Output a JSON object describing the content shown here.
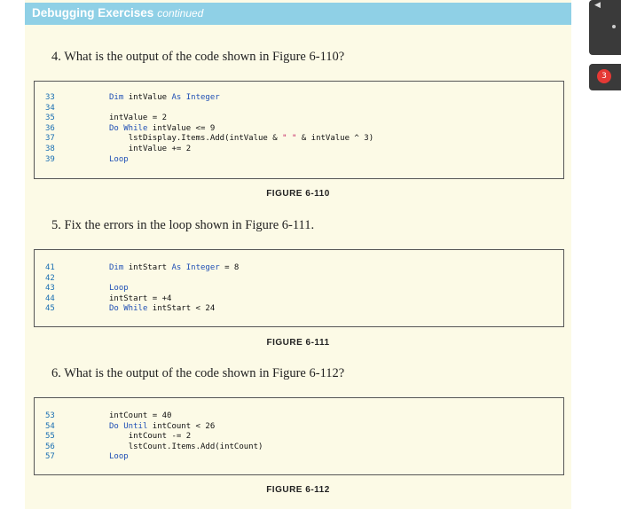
{
  "header": {
    "title": "Debugging Exercises",
    "subtitle": "continued"
  },
  "exercises": [
    {
      "question": "4. What is the output of the code shown in Figure 6-110?",
      "figure": "FIGURE 6-110",
      "lines": [
        {
          "num": "33",
          "code": "Dim intValue As Integer"
        },
        {
          "num": "34",
          "code": ""
        },
        {
          "num": "35",
          "code": "intValue = 2"
        },
        {
          "num": "36",
          "code": "Do While intValue <= 9"
        },
        {
          "num": "37",
          "code": "    lstDisplay.Items.Add(intValue & \" \" & intValue ^ 3)"
        },
        {
          "num": "38",
          "code": "    intValue += 2"
        },
        {
          "num": "39",
          "code": "Loop"
        }
      ]
    },
    {
      "question": "5. Fix the errors in the loop shown in Figure 6-111.",
      "figure": "FIGURE 6-111",
      "lines": [
        {
          "num": "41",
          "code": "Dim intStart As Integer = 8"
        },
        {
          "num": "42",
          "code": ""
        },
        {
          "num": "43",
          "code": "Loop"
        },
        {
          "num": "44",
          "code": "intStart = +4"
        },
        {
          "num": "45",
          "code": "Do While intStart < 24"
        }
      ]
    },
    {
      "question": "6. What is the output of the code shown in Figure 6-112?",
      "figure": "FIGURE 6-112",
      "lines": [
        {
          "num": "53",
          "code": "intCount = 40"
        },
        {
          "num": "54",
          "code": "Do Until intCount < 26"
        },
        {
          "num": "55",
          "code": "    intCount -= 2"
        },
        {
          "num": "56",
          "code": "    lstCount.Items.Add(intCount)"
        },
        {
          "num": "57",
          "code": "Loop"
        }
      ]
    }
  ],
  "side": {
    "badge_count": "3",
    "arrow_icon": "triangle-left-icon"
  },
  "colors": {
    "banner": "#8fd0e6",
    "page": "#fcfae6",
    "keyword": "#1f4fb5",
    "line_number": "#1a6fb3",
    "string": "#c2185b"
  }
}
